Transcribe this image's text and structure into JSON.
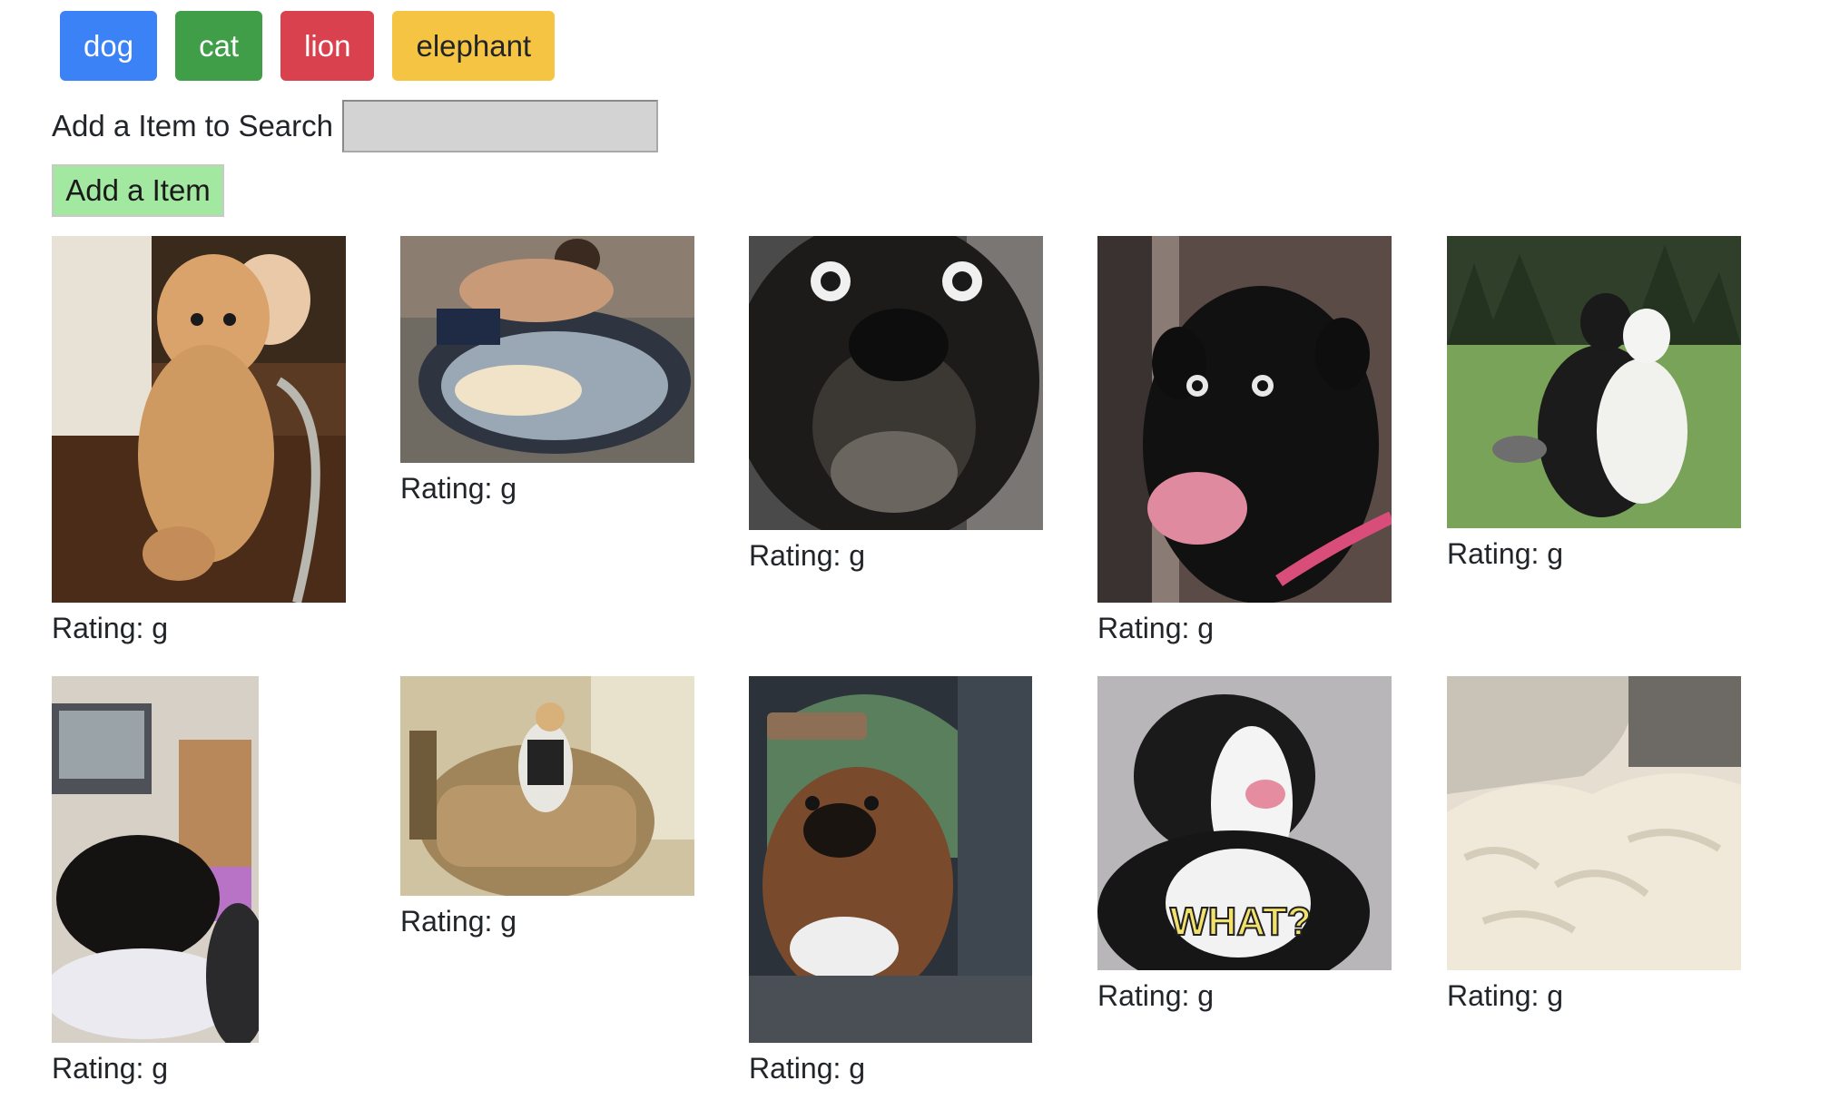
{
  "topics": [
    {
      "label": "dog",
      "color": "#3b82f6"
    },
    {
      "label": "cat",
      "color": "#3f9e47"
    },
    {
      "label": "lion",
      "color": "#d9414e"
    },
    {
      "label": "elephant",
      "color": "#f6c443"
    }
  ],
  "add_item": {
    "label": "Add a Item to Search",
    "input_value": "",
    "input_placeholder": "",
    "button_label": "Add a Item"
  },
  "gifs": [
    {
      "rating": "Rating: g",
      "content": "curly golden dog standing beside baby at high chair"
    },
    {
      "rating": "Rating: g",
      "content": "man bathing dog in round tub"
    },
    {
      "rating": "Rating: g",
      "content": "black dog with wide surprised eyes close-up"
    },
    {
      "rating": "Rating: g",
      "content": "black dog with pink collar surprised"
    },
    {
      "rating": "Rating: g",
      "content": "two border collies sitting on grass"
    },
    {
      "rating": "Rating: g",
      "content": "black puppy tumbling on blanket in living room"
    },
    {
      "rating": "Rating: g",
      "content": "dog in striped shirt on armchair"
    },
    {
      "rating": "Rating: g",
      "content": "boxer dog wearing green knit beanie in car"
    },
    {
      "rating": "Rating: g",
      "overlay_text": "WHAT?",
      "content": "black and white dog tilting head"
    },
    {
      "rating": "Rating: g",
      "content": "fluffy white shaggy rug with knit pillow"
    }
  ],
  "colors": {
    "input_bg": "#d3d3d3",
    "add_button_bg": "#a3e8a0"
  }
}
